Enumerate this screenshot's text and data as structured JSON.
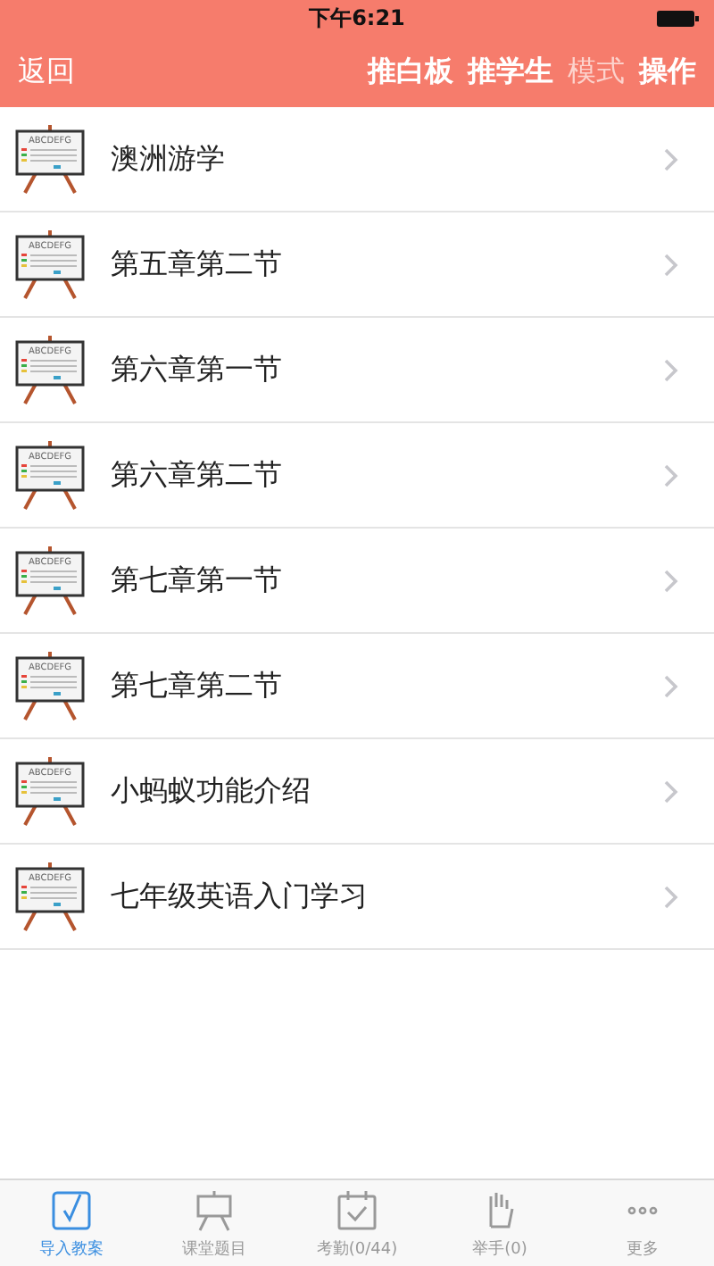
{
  "status_bar": {
    "time": "下午6:21"
  },
  "nav": {
    "back": "返回",
    "actions": [
      {
        "label": "推白板",
        "disabled": false
      },
      {
        "label": "推学生",
        "disabled": false
      },
      {
        "label": "模式",
        "disabled": true
      },
      {
        "label": "操作",
        "disabled": false
      }
    ]
  },
  "lessons": [
    {
      "title": "澳洲游学",
      "icon_text": "ABCDEFG"
    },
    {
      "title": "第五章第二节",
      "icon_text": "ABCDEFG"
    },
    {
      "title": "第六章第一节",
      "icon_text": "ABCDEFG"
    },
    {
      "title": "第六章第二节",
      "icon_text": "ABCDEFG"
    },
    {
      "title": "第七章第一节",
      "icon_text": "ABCDEFG"
    },
    {
      "title": "第七章第二节",
      "icon_text": "ABCDEFG"
    },
    {
      "title": "小蚂蚁功能介绍",
      "icon_text": "ABCDEFG"
    },
    {
      "title": "七年级英语入门学习",
      "icon_text": "ABCDEFG"
    }
  ],
  "tab_bar": [
    {
      "label": "导入教案",
      "kind": "import",
      "selected": true
    },
    {
      "label": "课堂题目",
      "kind": "board",
      "selected": false
    },
    {
      "label": "考勤(0/44)",
      "kind": "calendar",
      "selected": false
    },
    {
      "label": "举手(0)",
      "kind": "hand",
      "selected": false
    },
    {
      "label": "更多",
      "kind": "more",
      "selected": false
    }
  ]
}
